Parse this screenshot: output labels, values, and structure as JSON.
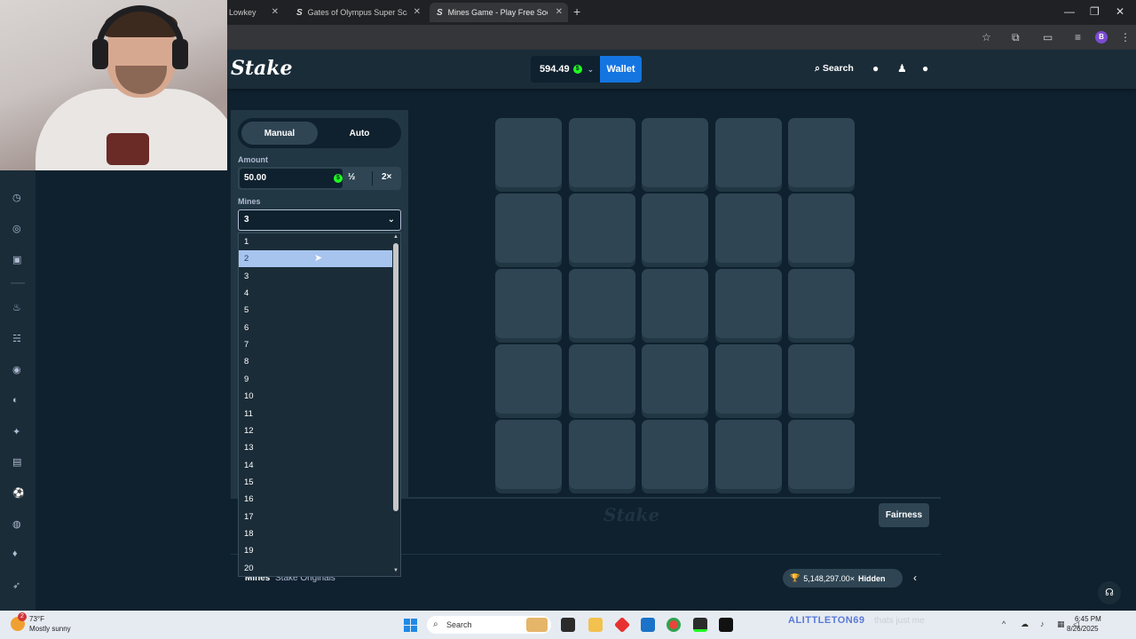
{
  "browser": {
    "tabs": [
      {
        "title": "Lowkey",
        "active": false
      },
      {
        "title": "Gates of Olympus Super Scatte",
        "active": false
      },
      {
        "title": "Mines Game - Play Free Social",
        "active": true
      }
    ],
    "new_tab": "+",
    "window_controls": {
      "minimize": "—",
      "restore": "❐",
      "close": "✕"
    },
    "profile_initial": "B"
  },
  "header": {
    "logo": "Stake",
    "balance": "594.49",
    "currency_symbol": "$",
    "wallet_label": "Wallet",
    "search_label": "Search"
  },
  "game": {
    "modes": [
      "Manual",
      "Auto"
    ],
    "active_mode": "Manual",
    "amount_label": "Amount",
    "amount_value": "50.00",
    "half_label": "½",
    "double_label": "2×",
    "mines_label": "Mines",
    "mines_selected": "3",
    "mines_options": [
      "1",
      "2",
      "3",
      "4",
      "5",
      "6",
      "7",
      "8",
      "9",
      "10",
      "11",
      "12",
      "13",
      "14",
      "15",
      "16",
      "17",
      "18",
      "19",
      "20"
    ],
    "highlighted_option": "2",
    "grid_rows": 5,
    "grid_cols": 5,
    "fairness_label": "Fairness",
    "footer_logo": "Stake"
  },
  "title_bar": {
    "game_name": "Mines",
    "provider": "Stake Originals",
    "jackpot": "5,148,297.00×",
    "hidden_label": "Hidden"
  },
  "taskbar": {
    "weather_temp": "73°F",
    "weather_desc": "Mostly sunny",
    "weather_badge": "2",
    "search_placeholder": "Search",
    "watermark": "ALITTLETON69",
    "watermark_sub": "thats just me",
    "time": "6:45 PM",
    "date": "8/26/2025"
  },
  "colors": {
    "bg": "#0f212e",
    "panel": "#213743",
    "tile": "#2f4553",
    "accent": "#1475e1",
    "coin": "#1fff20"
  }
}
